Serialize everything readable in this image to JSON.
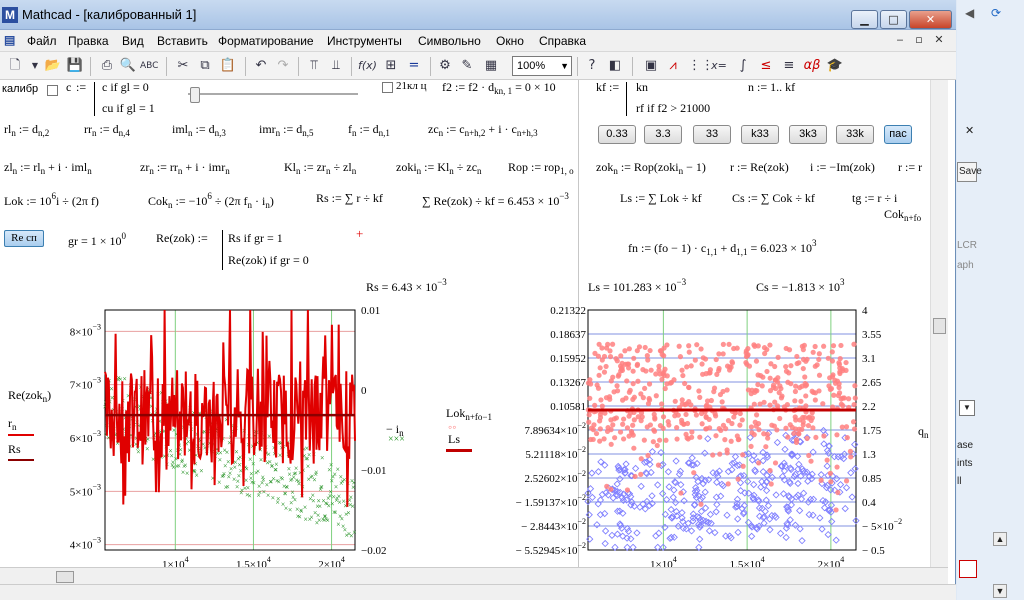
{
  "window": {
    "title": "Mathcad - [калиброванный 1]",
    "app_icon": "M",
    "btn_min": "▁",
    "btn_max": "□",
    "btn_close": "✕"
  },
  "menu": {
    "items": [
      "Файл",
      "Правка",
      "Вид",
      "Вставить",
      "Форматирование",
      "Инструменты",
      "Символьно",
      "Окно",
      "Справка"
    ],
    "mdi_min": "‒",
    "mdi_restore": "▫",
    "mdi_close": "✕"
  },
  "toolbar": {
    "zoom_value": "100%"
  },
  "worksheet": {
    "row1": {
      "kalibr_label": "калибр",
      "c_name": "c",
      "c_if": "c  if  gl = 0",
      "cu_if": "cu  if  gl = 1",
      "checkbox2_label": "21кл ц",
      "f2_expr": "f2 := f2 · d",
      "f2_sub": "kn, 1",
      "f2_tail": " = 0 × 10",
      "kf_name": "kf :=",
      "kf_kn": "kn",
      "kf_rf": "rf  if  f2 > 21000",
      "n_range": "n := 1.. kf"
    },
    "buttons": [
      "0.33",
      "3.3",
      "33",
      "k33",
      "3k3",
      "33k",
      "пас"
    ],
    "row2": {
      "rl": "rl",
      "rl_def": " := d",
      "rl_sub": "n,2",
      "rr": "rr",
      "rr_def": " := d",
      "rr_sub": "n,4",
      "iml": "iml",
      "iml_def": " := d",
      "iml_sub": "n,3",
      "imr": "imr",
      "imr_def": " := d",
      "imr_sub": "n,5",
      "f": "f",
      "f_def": " := d",
      "f_sub": "n,1",
      "zc": "zc",
      "zc_def": " := c",
      "zc_sub1": "n+h,2",
      "zc_mid": " + i · c",
      "zc_sub2": "n+h,3"
    },
    "row3": {
      "zl": "zl",
      "zl_def": " := rl",
      "zl_mid": " + i · iml",
      "zr": "zr",
      "zr_def": " := rr",
      "zr_mid": " + i · imr",
      "kl": "Kl",
      "kl_def": " := zr",
      "kl_mid": " ÷ zl",
      "zoki": "zoki",
      "zoki_def": " := Kl",
      "zoki_mid": " ÷ zc",
      "rop": "Rop := rop",
      "rop_sub": "1, o",
      "zok": "zok",
      "zok_def": " := Rop(zoki",
      "zok_tail": " − 1)",
      "r": "r := Re(zok)",
      "i": "i := −Im(zok)",
      "r_trunc": "r := r"
    },
    "row4": {
      "lok": "Lok := 10",
      "lok_exp": "6",
      "lok_tail": "i ÷ (2π f)",
      "cok": "Cok",
      "cok_def": " := −10",
      "cok_exp": "6",
      "cok_tail": " ÷ (2π f",
      "cok_tail2": " · i",
      "cok_end": ")",
      "rs": "Rs := ∑ r ÷ kf",
      "sum_re": "∑ Re(zok) ÷ kf = 6.453 × 10",
      "sum_re_exp": "−3",
      "ls": "Ls := ∑ Lok ÷ kf",
      "cs": "Cs := ∑ Cok ÷ kf",
      "tg": "tg := r ÷ i",
      "tg_cok": "Cok",
      "tg_cok_sub": "n+fo"
    },
    "recalc_button": "Re сп",
    "row5": {
      "gr": "gr = 1 × 10",
      "gr_exp": "0",
      "re_def": "Re(zok) :=",
      "re_rs": "Rs  if  gr = 1",
      "re_zok": "Re(zok)  if  gr = 0",
      "fn": "fn := (fo − 1) · c",
      "fn_sub1": "1,1",
      "fn_mid": " + d",
      "fn_sub2": "1,1",
      "fn_tail": " = 6.023 × 10",
      "fn_exp": "3"
    },
    "results": {
      "rs_val": "Rs = 6.43 × 10",
      "rs_exp": "−3",
      "ls_val": "Ls = 101.283 × 10",
      "ls_exp": "−3",
      "cs_val": "Cs = −1.813 × 10",
      "cs_exp": "3"
    },
    "plot1_legend": {
      "re_zok": "Re(zok",
      "re_zok_sub": "n",
      "re_zok_end": ")",
      "r_n": "r",
      "r_n_sub": "n",
      "rs": "Rs",
      "neg_i": "− i",
      "neg_i_sub": "n",
      "neg_i_marker": "×××"
    },
    "plot2_legend": {
      "lok": "Lok",
      "lok_sub": "n+fo−1",
      "lok_marker": "◦◦",
      "ls": "Ls",
      "q_label": "q",
      "q_sub": "n"
    }
  },
  "chart_data": [
    {
      "type": "line",
      "x_ticks": [
        "1×10",
        "1.5×10",
        "2×10"
      ],
      "x_tick_exp": "4",
      "y_left_ticks": [
        "8×10",
        "7×10",
        "6×10",
        "5×10",
        "4×10"
      ],
      "y_left_exp": "−3",
      "y_right_ticks": [
        "0.01",
        "0",
        "−0.01",
        "−0.02"
      ],
      "xlim": [
        5500,
        21500
      ],
      "ylim_left": [
        0.0039,
        0.0084
      ],
      "ylim_right": [
        -0.02,
        0.01
      ],
      "series": [
        {
          "name": "Re(zok_n)",
          "color": "#e00000",
          "style": "line",
          "approx_mean": 0.0064
        },
        {
          "name": "Rs",
          "color": "#8b0000",
          "style": "hline",
          "value": 0.00643
        },
        {
          "name": "−i_n",
          "color": "#1a8c1a",
          "style": "x-markers",
          "approx_range": [
            -0.018,
            0.0
          ]
        }
      ],
      "grid": true
    },
    {
      "type": "scatter",
      "x_ticks": [
        "1×10",
        "1.5×10",
        "2×10"
      ],
      "x_tick_exp": "4",
      "y_left_ticks": [
        "0.21322",
        "0.18637",
        "0.15952",
        "0.13267",
        "0.10581",
        "7.89634×10",
        "5.21118×10",
        "2.52602×10",
        "− 1.59137×10",
        "− 2.8443×10",
        "− 5.52945×10"
      ],
      "y_left_exp": "−2",
      "y_right_ticks": [
        "4",
        "3.55",
        "3.1",
        "2.65",
        "2.2",
        "1.75",
        "1.3",
        "0.85",
        "0.4",
        "− 5×10",
        "− 0.5"
      ],
      "y_right_exp_last": "−2",
      "xlim": [
        5500,
        21500
      ],
      "ylim_left": [
        -0.0552945,
        0.21322
      ],
      "ylim_right": [
        -0.5,
        4
      ],
      "series": [
        {
          "name": "Lok_n+fo−1",
          "color": "#ff8080",
          "style": "circles",
          "approx_mean": 0.12
        },
        {
          "name": "Ls",
          "color": "#c00000",
          "style": "hline",
          "value": 0.101283
        },
        {
          "name": "q_n",
          "color": "#8080ff",
          "style": "diamonds",
          "approx_range": [
            -0.4,
            2.3
          ]
        }
      ],
      "grid": true
    }
  ],
  "right_pane": {
    "save_label": "Save",
    "lcr": "LCR",
    "aph": "aph",
    "ase": "ase",
    "ints": "ints",
    "ll": "ll",
    "close_x": "✕"
  }
}
